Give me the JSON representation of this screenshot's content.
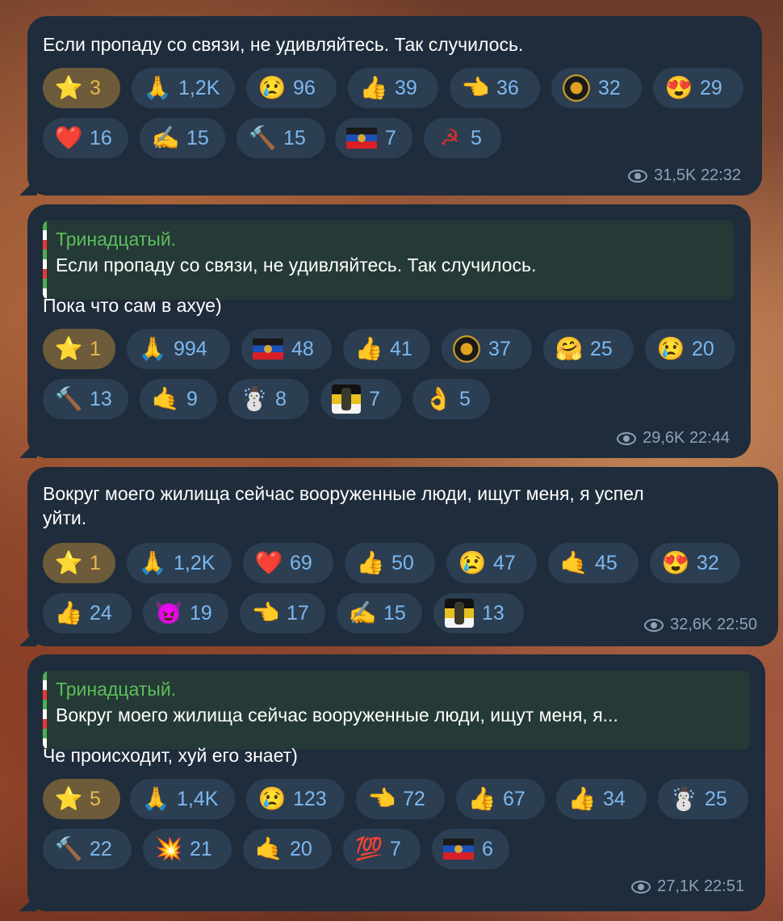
{
  "messages": [
    {
      "text": "Если пропаду со связи, не удивляйтесь. Так случилось.",
      "reactions": [
        {
          "icon": "star-icon",
          "emoji": "⭐",
          "count": "3"
        },
        {
          "icon": "pray-icon",
          "emoji": "🙏",
          "count": "1,2K"
        },
        {
          "icon": "crying-face-icon",
          "emoji": "😢",
          "count": "96"
        },
        {
          "icon": "thumbs-up-icon",
          "emoji": "👍",
          "count": "39"
        },
        {
          "icon": "pointing-hand-icon",
          "emoji": "👈",
          "count": "36"
        },
        {
          "icon": "wagner-badge-icon",
          "emoji": "",
          "count": "32"
        },
        {
          "icon": "heart-eyes-icon",
          "emoji": "😍",
          "count": "29"
        },
        {
          "icon": "heart-icon",
          "emoji": "❤️",
          "count": "16"
        },
        {
          "icon": "writing-hand-icon",
          "emoji": "✍️",
          "count": "15"
        },
        {
          "icon": "sledgehammer-icon",
          "emoji": "🔨",
          "count": "15"
        },
        {
          "icon": "dnr-flag-icon",
          "emoji": "",
          "count": "7"
        },
        {
          "icon": "red-star-icon",
          "emoji": "☭",
          "count": "5"
        }
      ],
      "views": "31,5K",
      "time": "22:32"
    },
    {
      "quote_author": "Тринадцатый.",
      "quote_text": "Если пропаду со связи, не удивляйтесь. Так случилось.",
      "text": "Пока что сам в ахуе)",
      "reactions": [
        {
          "icon": "star-icon",
          "emoji": "⭐",
          "count": "1"
        },
        {
          "icon": "pray-icon",
          "emoji": "🙏",
          "count": "994"
        },
        {
          "icon": "dnr-flag-icon",
          "emoji": "",
          "count": "48"
        },
        {
          "icon": "thumbs-up-icon",
          "emoji": "👍",
          "count": "41"
        },
        {
          "icon": "wagner-badge-icon",
          "emoji": "",
          "count": "37"
        },
        {
          "icon": "hugging-face-icon",
          "emoji": "🤗",
          "count": "25"
        },
        {
          "icon": "crying-face-icon",
          "emoji": "😢",
          "count": "20"
        },
        {
          "icon": "sledgehammer-icon",
          "emoji": "🔨",
          "count": "13"
        },
        {
          "icon": "shaka-hand-icon",
          "emoji": "🤙",
          "count": "9"
        },
        {
          "icon": "snowman-icon",
          "emoji": "☃️",
          "count": "8"
        },
        {
          "icon": "imperial-flag-soldier-icon",
          "emoji": "",
          "count": "7"
        },
        {
          "icon": "ok-hand-icon",
          "emoji": "👌",
          "count": "5"
        }
      ],
      "views": "29,6K",
      "time": "22:44"
    },
    {
      "text_line1": "Вокруг моего жилища сейчас вооруженные люди, ищут меня, я успел",
      "text_line2": "уйти.",
      "reactions": [
        {
          "icon": "star-icon",
          "emoji": "⭐",
          "count": "1"
        },
        {
          "icon": "pray-icon",
          "emoji": "🙏",
          "count": "1,2K"
        },
        {
          "icon": "heart-icon",
          "emoji": "❤️",
          "count": "69"
        },
        {
          "icon": "thumbs-up-icon",
          "emoji": "👍",
          "count": "50"
        },
        {
          "icon": "crying-face-icon",
          "emoji": "😢",
          "count": "47"
        },
        {
          "icon": "shaka-hand-icon",
          "emoji": "🤙",
          "count": "45"
        },
        {
          "icon": "heart-eyes-icon",
          "emoji": "😍",
          "count": "32"
        },
        {
          "icon": "vault-boy-icon",
          "emoji": "👍",
          "count": "24"
        },
        {
          "icon": "devil-face-icon",
          "emoji": "😈",
          "count": "19"
        },
        {
          "icon": "pointing-hand-icon",
          "emoji": "👈",
          "count": "17"
        },
        {
          "icon": "writing-hand-icon",
          "emoji": "✍️",
          "count": "15"
        },
        {
          "icon": "imperial-flag-soldier-icon",
          "emoji": "",
          "count": "13"
        }
      ],
      "views": "32,6K",
      "time": "22:50"
    },
    {
      "quote_author": "Тринадцатый.",
      "quote_text": "Вокруг моего жилища сейчас вооруженные люди, ищут меня, я...",
      "text": "Че происходит, хуй его знает)",
      "reactions": [
        {
          "icon": "star-icon",
          "emoji": "⭐",
          "count": "5"
        },
        {
          "icon": "pray-icon",
          "emoji": "🙏",
          "count": "1,4K"
        },
        {
          "icon": "crying-face-icon",
          "emoji": "😢",
          "count": "123"
        },
        {
          "icon": "pointing-hand-icon",
          "emoji": "👈",
          "count": "72"
        },
        {
          "icon": "thumbs-up-icon",
          "emoji": "👍",
          "count": "67"
        },
        {
          "icon": "vault-boy-icon",
          "emoji": "👍",
          "count": "34"
        },
        {
          "icon": "snowman-icon",
          "emoji": "☃️",
          "count": "25"
        },
        {
          "icon": "sledgehammer-icon",
          "emoji": "🔨",
          "count": "22"
        },
        {
          "icon": "mushroom-cloud-icon",
          "emoji": "💥",
          "count": "21"
        },
        {
          "icon": "shaka-hand-icon",
          "emoji": "🤙",
          "count": "20"
        },
        {
          "icon": "hundred-points-icon",
          "emoji": "💯",
          "count": "7"
        },
        {
          "icon": "dnr-flag-icon",
          "emoji": "",
          "count": "6"
        }
      ],
      "views": "27,1K",
      "time": "22:51"
    }
  ]
}
